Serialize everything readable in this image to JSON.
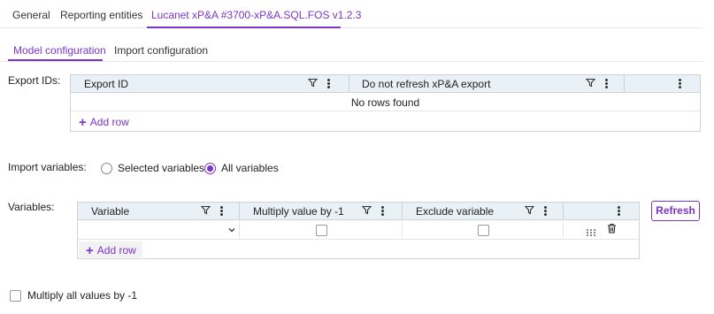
{
  "tabs": [
    {
      "label": "General"
    },
    {
      "label": "Reporting entities"
    },
    {
      "label": "Lucanet xP&A #3700-xP&A.SQL.FOS v1.2.3"
    }
  ],
  "sub_tabs": [
    {
      "label": "Model configuration"
    },
    {
      "label": "Import configuration"
    }
  ],
  "export_ids": {
    "label": "Export IDs:",
    "columns": [
      {
        "title": "Export ID"
      },
      {
        "title": "Do not refresh xP&A export"
      }
    ],
    "empty_text": "No rows found",
    "add_row": "Add row"
  },
  "import_variables": {
    "label": "Import variables:",
    "options": [
      {
        "label": "Selected variables",
        "selected": false
      },
      {
        "label": "All variables",
        "selected": true
      }
    ]
  },
  "variables": {
    "label": "Variables:",
    "columns": [
      {
        "title": "Variable"
      },
      {
        "title": "Multiply value by -1"
      },
      {
        "title": "Exclude variable"
      }
    ],
    "rows": [
      {
        "variable": "",
        "multiply": false,
        "exclude": false
      }
    ],
    "add_row": "Add row",
    "refresh": "Refresh"
  },
  "multiply_all": {
    "label": "Multiply all values by -1",
    "checked": false
  },
  "colors": {
    "accent": "#7b35c8",
    "grid_header": "#e9f0f6",
    "grid_border": "#cdd3d9"
  }
}
